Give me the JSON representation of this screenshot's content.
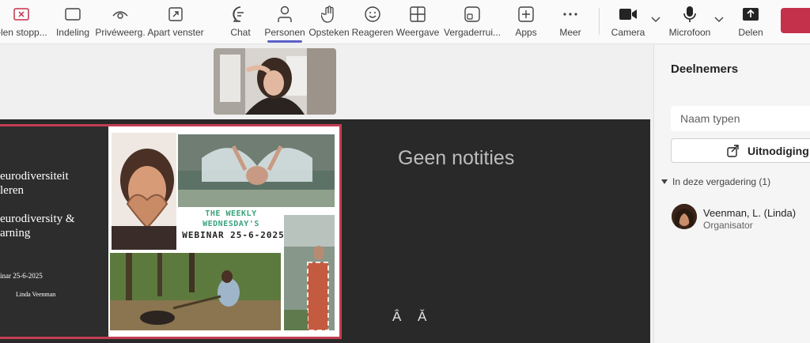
{
  "toolbar": {
    "buttons": [
      {
        "id": "stop-sharing",
        "label": "Delen stoppen",
        "icon": "stop-share-icon"
      },
      {
        "id": "layout",
        "label": "Indeling",
        "icon": "layout-icon"
      },
      {
        "id": "private-view",
        "label": "Privéweergave",
        "icon": "eye-icon"
      },
      {
        "id": "separate-window",
        "label": "Apart venster",
        "icon": "popout-icon"
      },
      {
        "id": "chat",
        "label": "Chat",
        "icon": "chat-icon"
      },
      {
        "id": "people",
        "label": "Personen",
        "icon": "person-icon"
      },
      {
        "id": "raise-hand",
        "label": "Opsteken",
        "icon": "hand-icon"
      },
      {
        "id": "react",
        "label": "Reageren",
        "icon": "smiley-icon"
      },
      {
        "id": "view",
        "label": "Weergave",
        "icon": "grid-icon"
      },
      {
        "id": "rooms",
        "label": "Vergaderruimtes",
        "icon": "rooms-icon"
      },
      {
        "id": "apps",
        "label": "Apps",
        "icon": "apps-plus-icon"
      },
      {
        "id": "more",
        "label": "Meer",
        "icon": "more-dots-icon"
      },
      {
        "id": "camera",
        "label": "Camera",
        "icon": "camera-icon"
      },
      {
        "id": "mic",
        "label": "Microfoon",
        "icon": "microphone-icon"
      },
      {
        "id": "share",
        "label": "Delen",
        "icon": "share-up-icon"
      }
    ],
    "labels_display": {
      "stop-sharing": "elen stopp...",
      "private-view": "Privéweerg.",
      "rooms": "Vergaderrui..."
    },
    "active": "Personen",
    "accent_color": "#5b5fc7",
    "leave_color": "#c4314b"
  },
  "slide": {
    "title_nl": "eurodiversiteit\nleren",
    "title_en": "eurodiversity &\narning",
    "date": "inar 25-6-2025",
    "presenter": "Linda Veenman",
    "weekly_line1": "THE WEEKLY",
    "weekly_line2": "WEDNESDAY'S",
    "webinar": "WEBINAR 25-6-2025"
  },
  "notes": {
    "empty_text": "Geen notities",
    "font_increase": "Â",
    "font_decrease": "Ǎ"
  },
  "panel": {
    "title": "Deelnemers",
    "search_placeholder": "Naam typen",
    "invite_label": "Uitnodiging d",
    "section_label": "In deze vergadering (1)",
    "participants": [
      {
        "name": "Veenman, L. (Linda)",
        "role": "Organisator"
      }
    ]
  }
}
